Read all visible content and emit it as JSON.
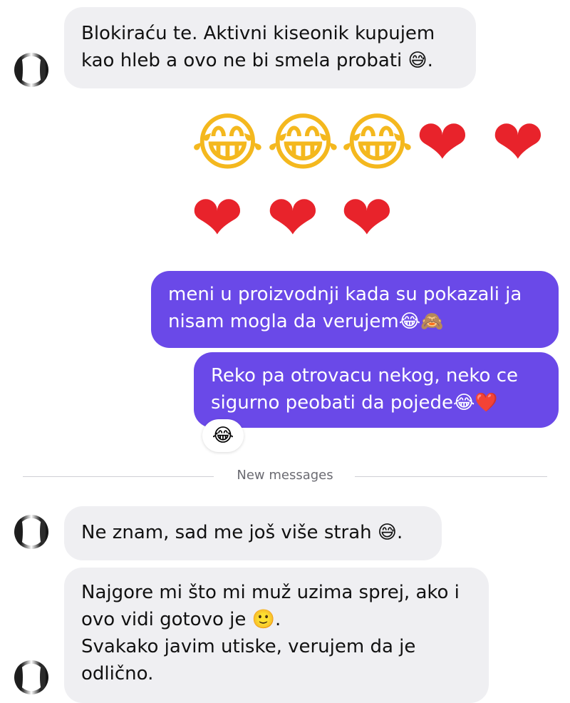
{
  "messages": {
    "m1": {
      "line1": "Blokiraću te. Aktivni kiseonik kupujem",
      "line2": "kao hleb a ovo ne bi smela probati 😅."
    },
    "emoji_row1": [
      "😂",
      "😂",
      "😂",
      "❤",
      "❤"
    ],
    "emoji_row2": [
      "❤",
      "❤",
      "❤"
    ],
    "m2": {
      "line1": "meni u proizvodnji kada su pokazali ja",
      "line2": "nisam mogla da verujem😂🙈"
    },
    "m3": {
      "line1": "Reko pa otrovacu nekog, neko ce",
      "line2": "sigurno peobati da pojede😂❤️",
      "reaction": "😂"
    },
    "divider_label": "New messages",
    "m4": {
      "line1": "Ne znam, sad me još više strah 😅."
    },
    "m5": {
      "line1": "Najgore mi što mi muž uzima sprej, ako i",
      "line2": "ovo vidi gotovo je 🙂.",
      "line3": "Svakako javim utiske, verujem da je",
      "line4": "odlično."
    }
  },
  "colors": {
    "incoming_bubble": "#efeff2",
    "outgoing_bubble": "#6a49e8",
    "heart": "#e8232b"
  }
}
